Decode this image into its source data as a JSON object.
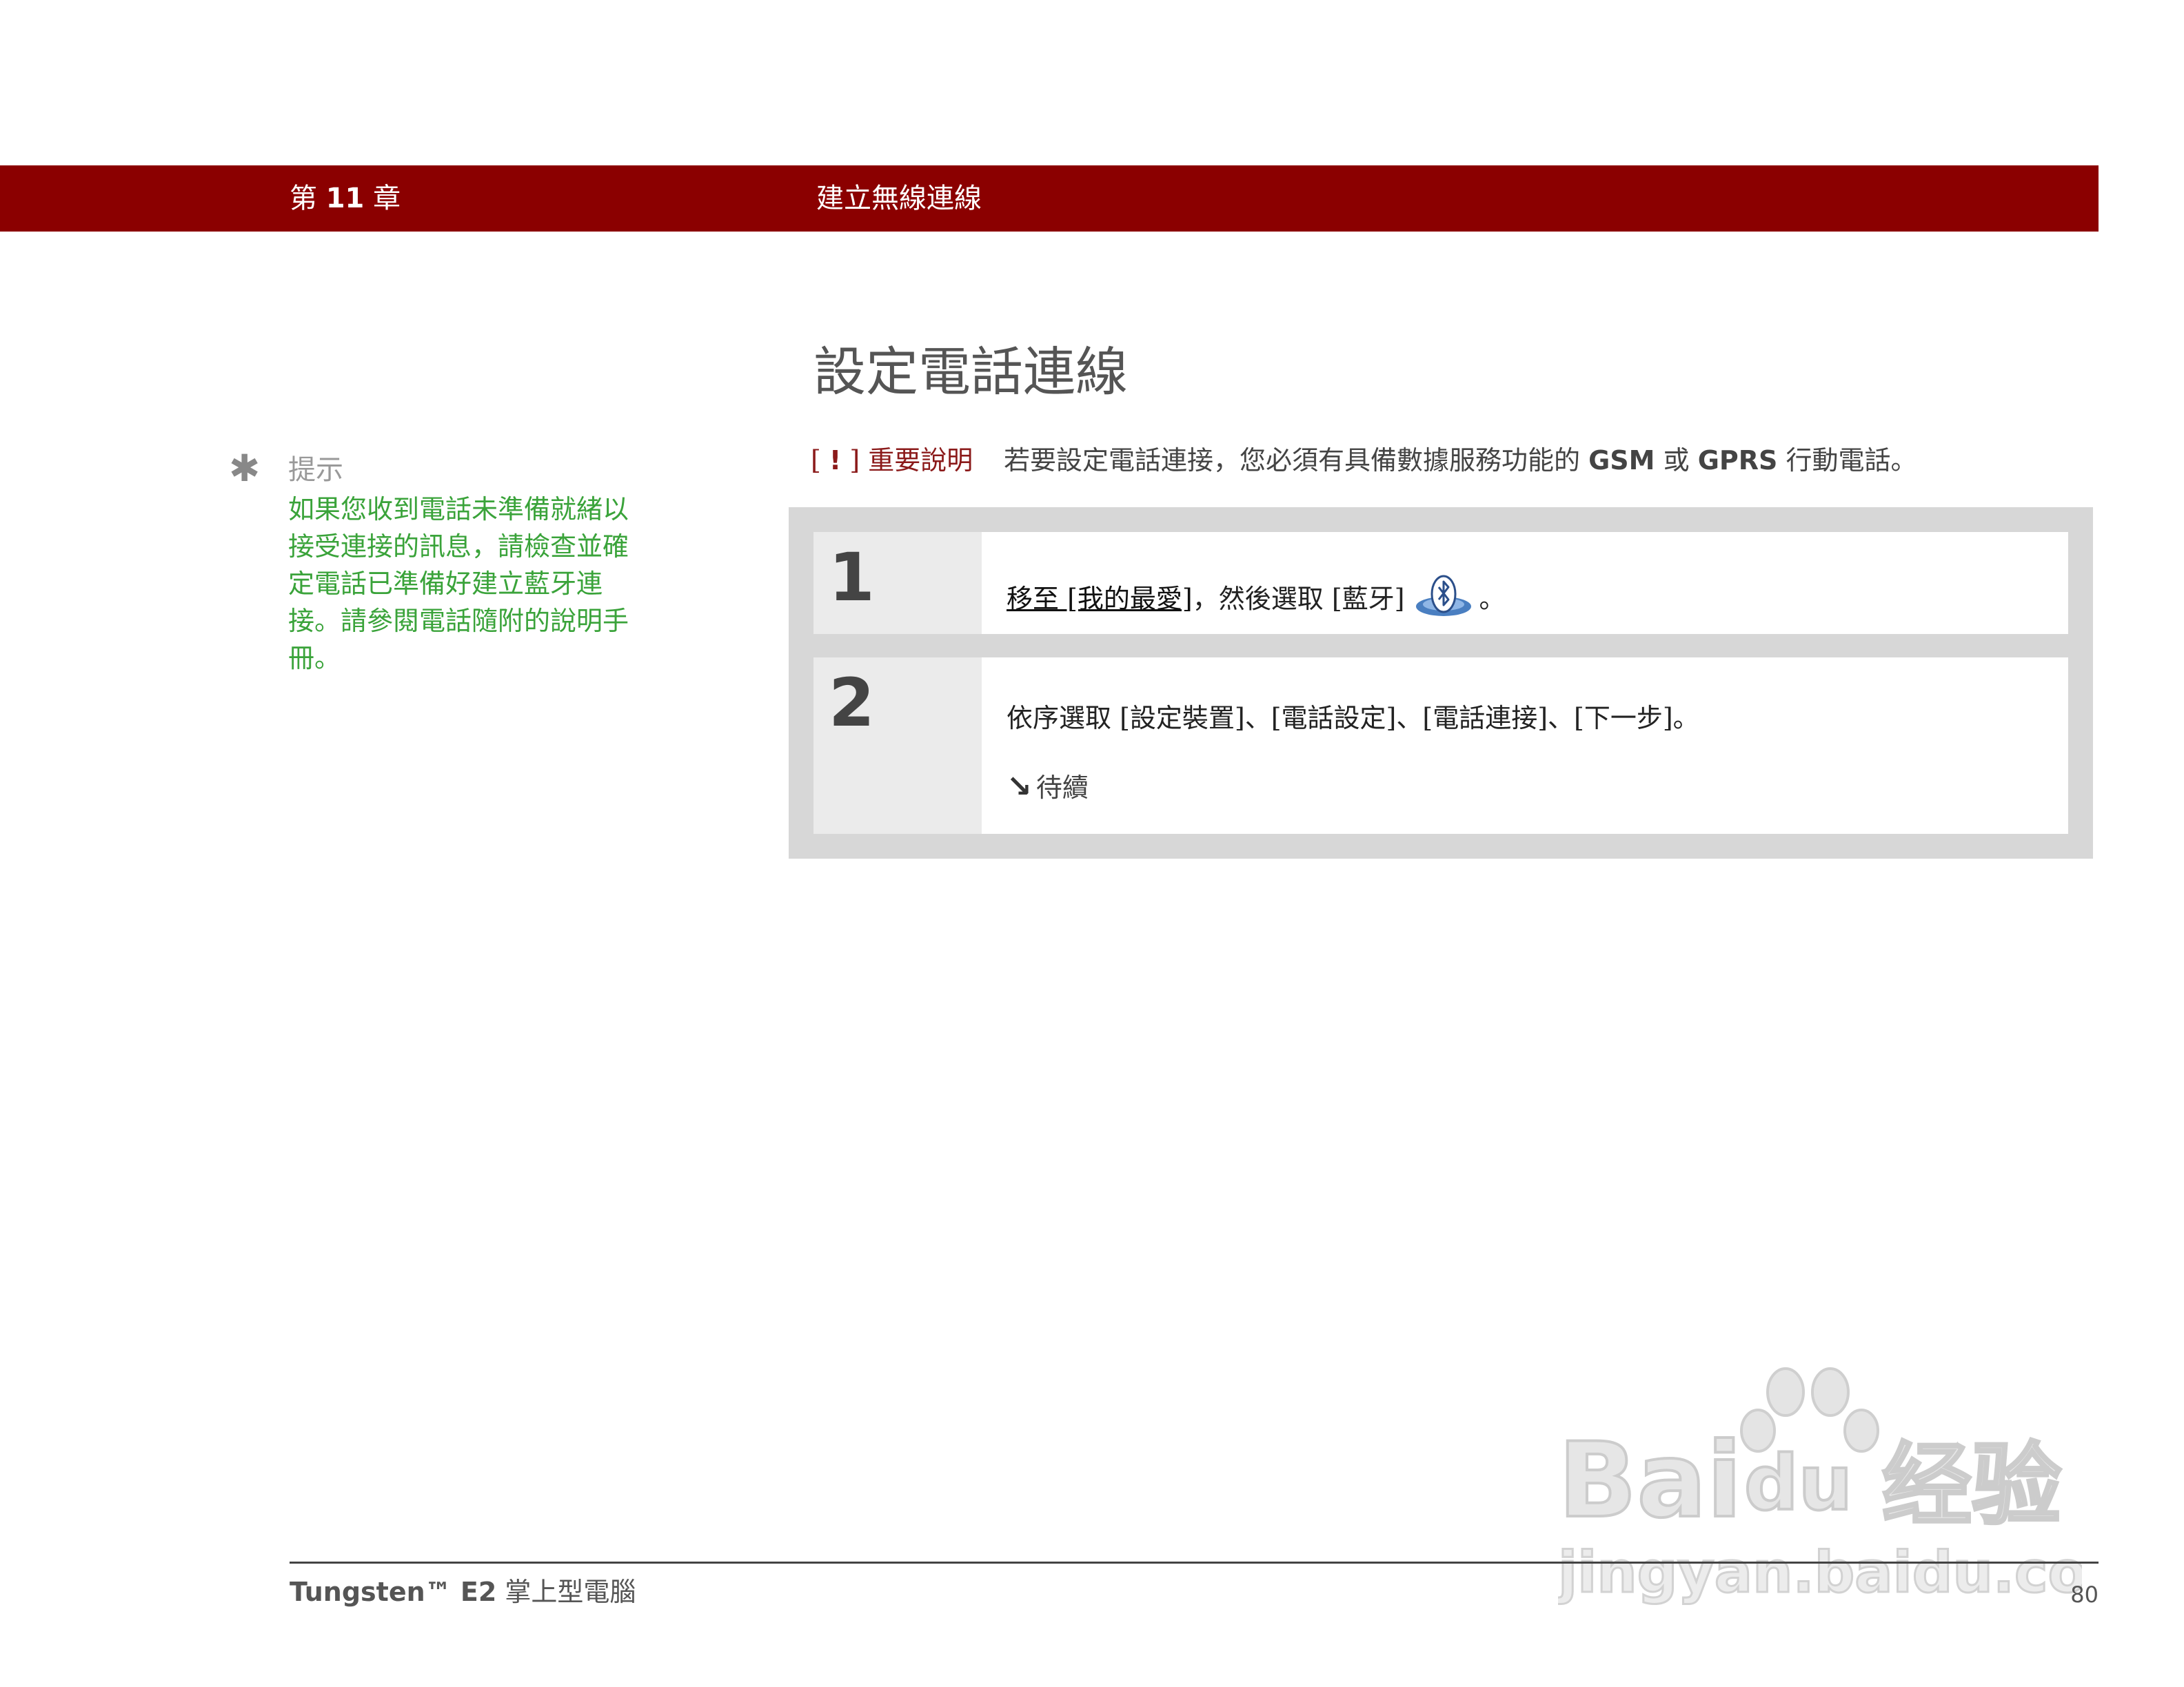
{
  "header": {
    "chapter_prefix": "第",
    "chapter_number": "11",
    "chapter_suffix": "章",
    "section": "建立無線連線"
  },
  "page_title": "設定電話連線",
  "important": {
    "bracket_open": "[",
    "bang": "!",
    "bracket_close": "]",
    "label": "重要說明",
    "text_before_gsm": "若要設定電話連接，您必須有具備數據服務功能的",
    "gsm": "GSM",
    "or": "或",
    "gprs": "GPRS",
    "text_end": "行動電話。"
  },
  "tip": {
    "icon": "asterisk-icon",
    "heading": "提示",
    "body": "如果您收到電話未準備就緒以接受連接的訊息，請檢查並確定電話已準備好建立藍牙連接。請參閱電話隨附的說明手冊。"
  },
  "steps": [
    {
      "number": "1",
      "link": "移至 [我的最愛]",
      "text": "，然後選取 [藍牙]",
      "icon": "bluetooth-icon",
      "end": "。"
    },
    {
      "number": "2",
      "text": "依序選取 [設定裝置]、[電話設定]、[電話連接]、[下一步]。",
      "continued": "待續",
      "continued_icon": "arrow-down-right-icon"
    }
  ],
  "watermark": {
    "brand": "Bai du 经验",
    "url": "jingyan.baidu.com"
  },
  "footer": {
    "product": "Tungsten™ E2",
    "product_desc": "掌上型電腦",
    "page_number": "80"
  },
  "colors": {
    "header_band": "#8b0000",
    "important": "#8b1a1a",
    "tip_text": "#3aa33a",
    "steps_frame": "#d7d7d7",
    "step_number_bg": "#ebebeb"
  }
}
